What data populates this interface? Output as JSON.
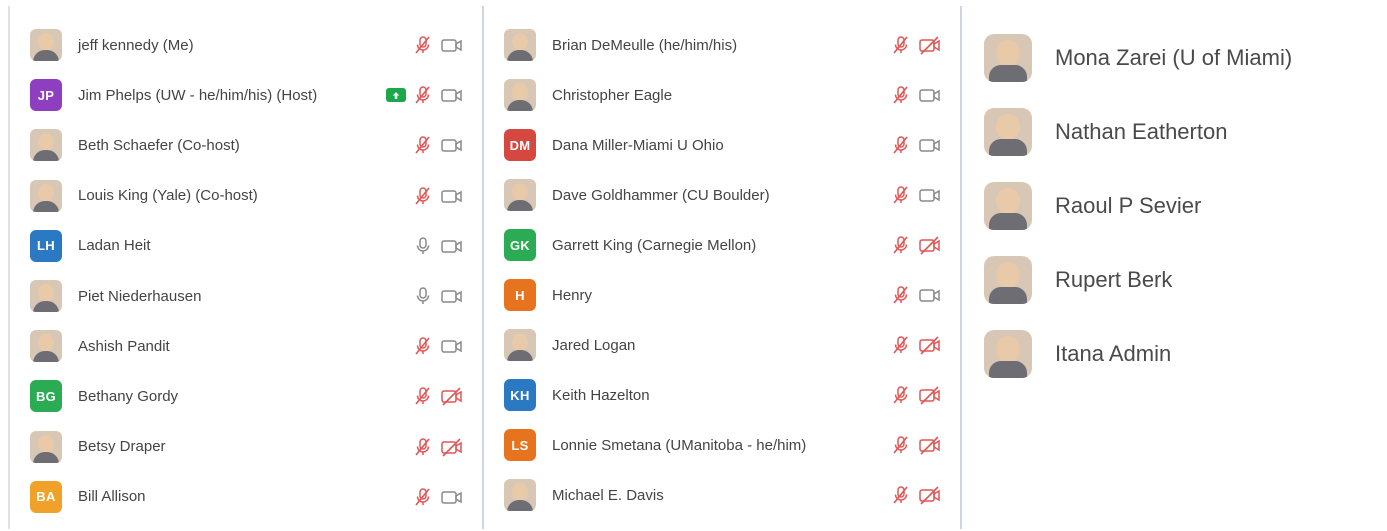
{
  "colors": {
    "muted_red": "#e25555",
    "icon_gray": "#8a8a8a",
    "share_green": "#1aa84a"
  },
  "panels": [
    {
      "participants": [
        {
          "name": "jeff kennedy (Me)",
          "initials": "",
          "color": "",
          "mic": "muted",
          "video": "on"
        },
        {
          "name": "Jim Phelps (UW - he/him/his) (Host)",
          "initials": "JP",
          "color": "#8e3fc0",
          "mic": "muted",
          "video": "on",
          "sharing": true
        },
        {
          "name": "Beth Schaefer (Co-host)",
          "initials": "",
          "color": "",
          "mic": "muted",
          "video": "on"
        },
        {
          "name": "Louis King (Yale) (Co-host)",
          "initials": "",
          "color": "",
          "mic": "muted",
          "video": "on"
        },
        {
          "name": "Ladan Heit",
          "initials": "LH",
          "color": "#2b79c2",
          "mic": "on",
          "video": "on"
        },
        {
          "name": "Piet Niederhausen",
          "initials": "",
          "color": "",
          "mic": "on",
          "video": "on"
        },
        {
          "name": "Ashish Pandit",
          "initials": "",
          "color": "",
          "mic": "muted",
          "video": "on"
        },
        {
          "name": "Bethany Gordy",
          "initials": "BG",
          "color": "#2aab54",
          "mic": "muted",
          "video": "off"
        },
        {
          "name": "Betsy Draper",
          "initials": "",
          "color": "",
          "mic": "muted",
          "video": "off"
        },
        {
          "name": "Bill Allison",
          "initials": "BA",
          "color": "#efa12a",
          "mic": "muted",
          "video": "on"
        }
      ]
    },
    {
      "participants": [
        {
          "name": "Brian DeMeulle (he/him/his)",
          "initials": "",
          "color": "",
          "mic": "muted",
          "video": "off"
        },
        {
          "name": "Christopher Eagle",
          "initials": "",
          "color": "",
          "mic": "muted",
          "video": "on"
        },
        {
          "name": "Dana Miller-Miami U Ohio",
          "initials": "DM",
          "color": "#d5473f",
          "mic": "muted",
          "video": "on"
        },
        {
          "name": "Dave Goldhammer (CU Boulder)",
          "initials": "",
          "color": "",
          "mic": "muted",
          "video": "on"
        },
        {
          "name": "Garrett King (Carnegie Mellon)",
          "initials": "GK",
          "color": "#2aab54",
          "mic": "muted",
          "video": "off"
        },
        {
          "name": "Henry",
          "initials": "H",
          "color": "#e8731f",
          "mic": "muted",
          "video": "on"
        },
        {
          "name": "Jared Logan",
          "initials": "",
          "color": "",
          "mic": "muted",
          "video": "off"
        },
        {
          "name": "Keith Hazelton",
          "initials": "KH",
          "color": "#2b79c2",
          "mic": "muted",
          "video": "off"
        },
        {
          "name": "Lonnie Smetana (UManitoba - he/him)",
          "initials": "LS",
          "color": "#e8731f",
          "mic": "muted",
          "video": "off"
        },
        {
          "name": "Michael E. Davis",
          "initials": "",
          "color": "",
          "mic": "muted",
          "video": "off"
        }
      ]
    },
    {
      "participants": [
        {
          "name": "Mona Zarei (U of Miami)",
          "initials": "",
          "color": ""
        },
        {
          "name": "Nathan Eatherton",
          "initials": "",
          "color": ""
        },
        {
          "name": "Raoul P Sevier",
          "initials": "",
          "color": ""
        },
        {
          "name": "Rupert Berk",
          "initials": "",
          "color": ""
        },
        {
          "name": "Itana Admin",
          "initials": "",
          "color": ""
        }
      ]
    }
  ]
}
